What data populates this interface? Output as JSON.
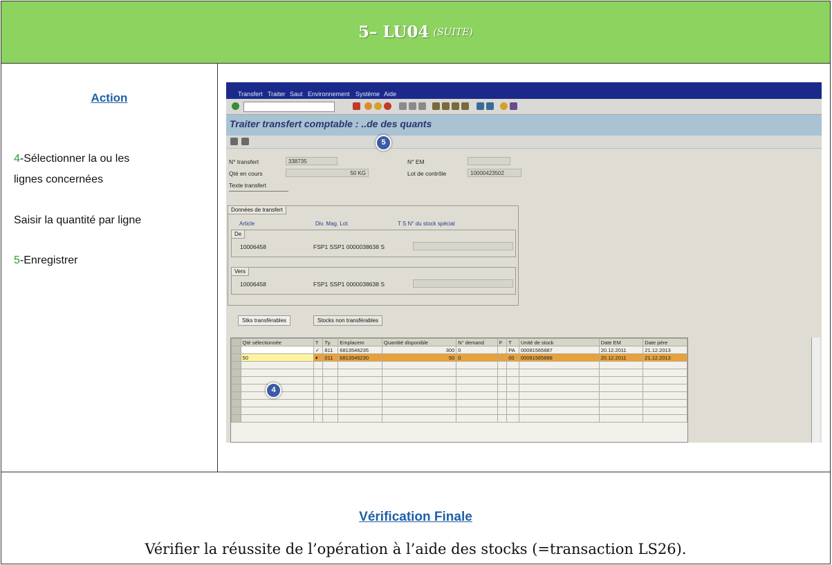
{
  "header": {
    "title": "5– LU04",
    "suite": "(SUITE)"
  },
  "action": {
    "title": "Action",
    "step4_num": "4",
    "step4_text": "-Sélectionner la ou les",
    "step4_text2": "lignes concernées",
    "step_qty": "Saisir la quantité par ligne",
    "step5_num": "5",
    "step5_text": "-Enregistrer"
  },
  "sap": {
    "menu": [
      "Transfert",
      "Traiter",
      "Saut",
      "Environnement",
      "Système",
      "Aide"
    ],
    "screen_title": "Traiter transfert comptable : ..de des quants",
    "fields": {
      "transfert_label": "N° transfert",
      "transfert_value": "338735",
      "em_label": "N° EM",
      "qte_label": "Qté en cours",
      "qte_value": "50 KG",
      "lot_label": "Lot de contrôle",
      "lot_value": "10000423502",
      "texte_label": "Texte transfert"
    },
    "transfer_group": {
      "label": "Données de transfert",
      "col_article": "Article",
      "col_div_mag_lot": "Div. Mag. Lot",
      "col_special": "T S N° du stock spécial",
      "de_label": "De",
      "de_article": "10006458",
      "de_rest": "FSP1 SSP1 0000038638 S",
      "vers_label": "Vers",
      "vers_article": "10006458",
      "vers_rest": "FSP1 SSP1 0000038638 S"
    },
    "tabs": [
      "Stks transférables",
      "Stocks non transférables"
    ],
    "table": {
      "headers": [
        "Qté sélectionnée",
        "T",
        "Ty.",
        "Emplacem",
        "Quantité disponible",
        "N° demand",
        "F",
        "T",
        "Unité de stock",
        "Date EM",
        "Date pére"
      ],
      "rows": [
        {
          "qty": "",
          "t": "✓",
          "ty": "811",
          "emp": "6813546235",
          "dispo": "300",
          "dem": "0",
          "f": "",
          "t2": "PA",
          "unite": "00081565887",
          "date_em": "20.12.2011",
          "date_pere": "21.12.2013"
        },
        {
          "qty": "50",
          "t": "▾",
          "ty": "011",
          "emp": "6813546230",
          "dispo": "50",
          "dem": "0",
          "f": "",
          "t2": "00",
          "unite": "00081565888",
          "date_em": "20.12.2011",
          "date_pere": "21.12.2013"
        }
      ]
    },
    "callouts": {
      "c4": "4",
      "c5": "5"
    }
  },
  "final": {
    "title": "Vérification Finale",
    "text": "Vérifier la réussite de l’opération à l’aide des stocks (=transaction LS26)."
  }
}
